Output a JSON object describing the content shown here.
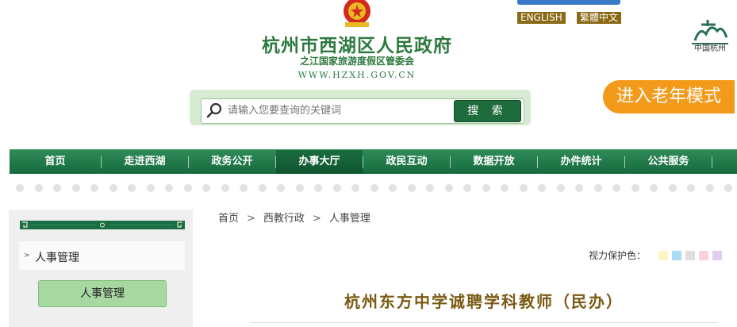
{
  "header": {
    "site_title": "杭州市西湖区人民政府",
    "site_subtitle": "之江国家旅游度假区管委会",
    "site_url": "WWW.HZXH.GOV.CN",
    "lang_english": "ENGLISH",
    "lang_traditional": "繁體中文",
    "city_logo_text": "中国杭州",
    "elder_mode": "进入老年模式"
  },
  "search": {
    "placeholder": "请输入您要查询的关键词",
    "button_label": "搜 索"
  },
  "nav": {
    "items": [
      {
        "label": "首页"
      },
      {
        "label": "走进西湖"
      },
      {
        "label": "政务公开"
      },
      {
        "label": "办事大厅"
      },
      {
        "label": "政民互动"
      },
      {
        "label": "数据开放"
      },
      {
        "label": "办件统计"
      },
      {
        "label": "公共服务"
      }
    ],
    "active_index": 3
  },
  "sidebar": {
    "item_label": "人事管理",
    "button_label": "人事管理"
  },
  "breadcrumb": {
    "items": [
      "首页",
      "西教行政",
      "人事管理"
    ],
    "separator": ">"
  },
  "vision": {
    "label": "视力保护色：",
    "colors": [
      "#fdf6c3",
      "#a9dcf5",
      "#dedede",
      "#fbd2dc",
      "#e2ccf2"
    ]
  },
  "article": {
    "title": "杭州东方中学诚聘学科教师（民办）"
  },
  "colors": {
    "brand_green": "#1e6b3c",
    "elder_orange": "#f39a1a",
    "title_brown": "#7a5a12"
  }
}
